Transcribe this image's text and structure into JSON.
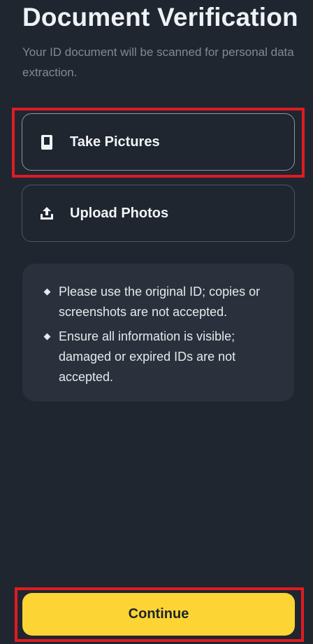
{
  "header": {
    "title": "Document Verification",
    "subtitle": "Your ID document will be scanned for personal data extraction."
  },
  "options": [
    {
      "label": "Take Pictures",
      "icon": "phone-icon",
      "selected": true
    },
    {
      "label": "Upload Photos",
      "icon": "upload-icon",
      "selected": false
    }
  ],
  "info": {
    "items": [
      "Please use the original ID; copies or screenshots are not accepted.",
      "Ensure all information is visible; damaged or expired IDs are not accepted."
    ]
  },
  "footer": {
    "continue_label": "Continue"
  },
  "colors": {
    "background": "#1f2630",
    "card_border": "#4b5563",
    "info_background": "#2a313c",
    "accent": "#fcd535",
    "highlight": "#e01b22"
  }
}
